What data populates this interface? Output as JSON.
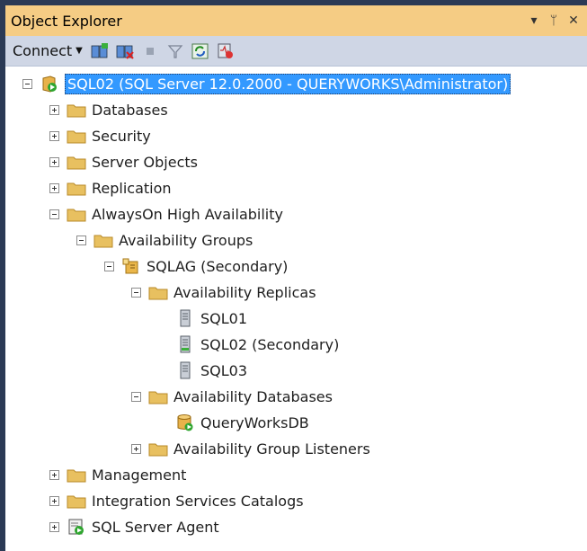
{
  "window": {
    "title": "Object Explorer",
    "pin_glyph": "▾ ⊥",
    "close_glyph": "✕"
  },
  "toolbar": {
    "connect_label": "Connect",
    "buttons": [
      "connect-object-explorer-icon",
      "disconnect-icon",
      "stop-icon",
      "filter-icon",
      "refresh-icon",
      "activity-monitor-icon"
    ]
  },
  "tree": {
    "server": "SQL02 (SQL Server 12.0.2000 - QUERYWORKS\\Administrator)",
    "databases": "Databases",
    "security": "Security",
    "server_objects": "Server Objects",
    "replication": "Replication",
    "alwayson": "AlwaysOn High Availability",
    "availability_groups": "Availability Groups",
    "sqlag": "SQLAG (Secondary)",
    "availability_replicas": "Availability Replicas",
    "replica_1": "SQL01",
    "replica_2": "SQL02 (Secondary)",
    "replica_3": "SQL03",
    "availability_databases": "Availability Databases",
    "db_1": "QueryWorksDB",
    "listeners": "Availability Group Listeners",
    "management": "Management",
    "integration": "Integration Services Catalogs",
    "agent": "SQL Server Agent"
  },
  "colors": {
    "title_bg": "#f5cc84",
    "toolbar_bg": "#cfd6e5",
    "selection_bg": "#3399ff",
    "folder": "#e8c060"
  }
}
